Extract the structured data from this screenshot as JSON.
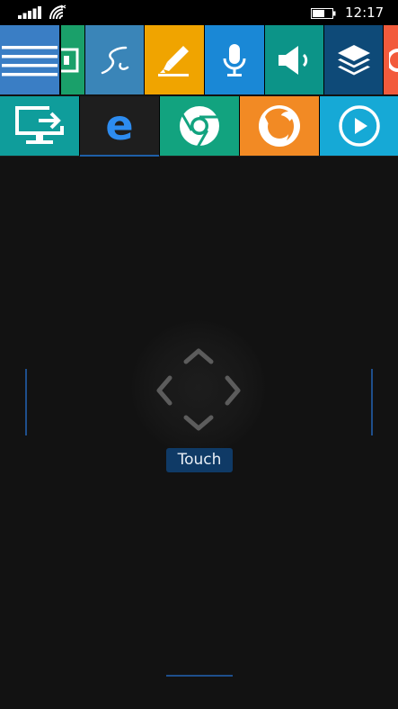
{
  "status_bar": {
    "time": "12:17",
    "icons": [
      "signal-icon",
      "wifi-icon",
      "battery-icon"
    ]
  },
  "toolbar_row1": [
    {
      "name": "menu",
      "icon": "hamburger-menu-icon",
      "color": "#3a7ec5"
    },
    {
      "name": "keyboard",
      "icon": "keyboard-icon",
      "color": "#1aa06a"
    },
    {
      "name": "pen",
      "icon": "pen-signature-icon",
      "color": "#3a85b8"
    },
    {
      "name": "highlighter",
      "icon": "highlighter-icon",
      "color": "#f0a400"
    },
    {
      "name": "microphone",
      "icon": "microphone-icon",
      "color": "#1a88d6"
    },
    {
      "name": "volume",
      "icon": "speaker-icon",
      "color": "#0c9488"
    },
    {
      "name": "layers",
      "icon": "layers-icon",
      "color": "#0e4a78"
    },
    {
      "name": "partial",
      "icon": "partial-icon",
      "color": "#f25b3c"
    }
  ],
  "toolbar_row2": [
    {
      "name": "remote-desktop",
      "icon": "monitor-arrow-icon",
      "color": "#0f9d9b"
    },
    {
      "name": "edge",
      "icon": "edge-e-icon",
      "color": "#1e1e1e"
    },
    {
      "name": "chrome",
      "icon": "chrome-icon",
      "color": "#12a37f"
    },
    {
      "name": "firefox",
      "icon": "firefox-icon",
      "color": "#f28a24"
    },
    {
      "name": "media-player",
      "icon": "play-circle-icon",
      "color": "#16a9d6"
    }
  ],
  "touchpad": {
    "mode_label": "Touch"
  },
  "colors": {
    "background": "#121212",
    "accent": "#1e5fa8",
    "label_bg": "#0f3a66"
  }
}
